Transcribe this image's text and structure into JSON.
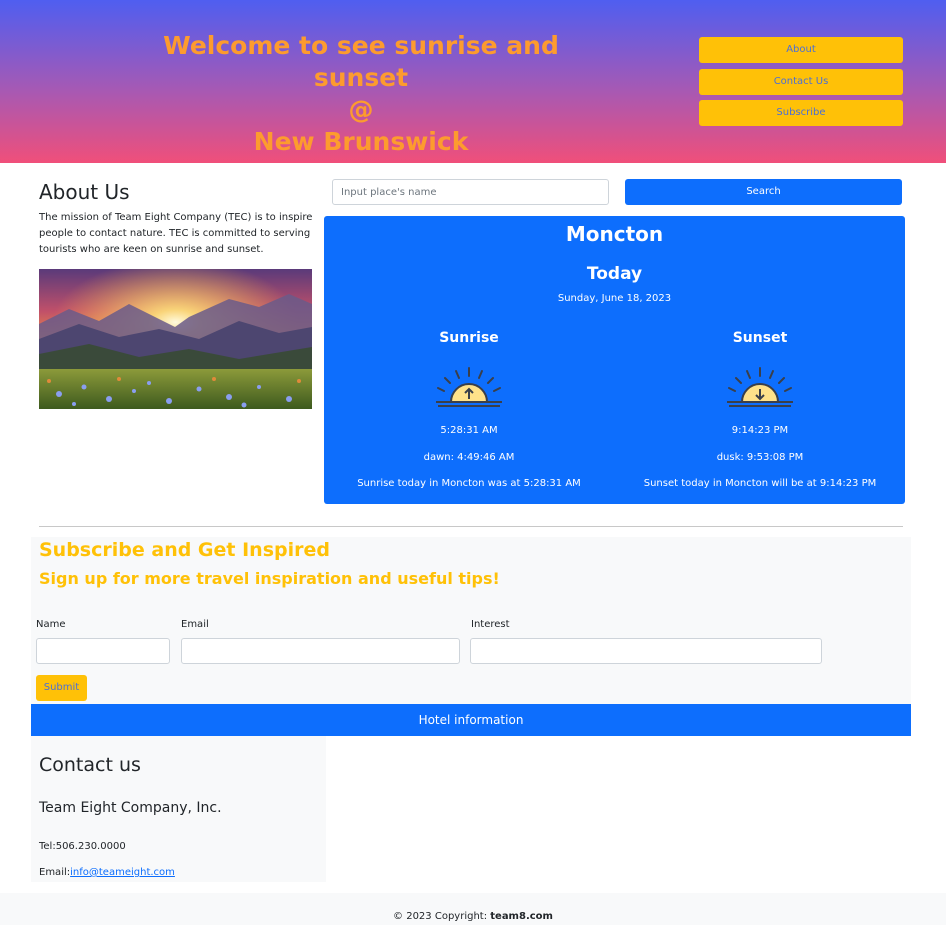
{
  "header": {
    "title_line1": "Welcome to see sunrise and sunset",
    "title_line2": "@",
    "title_line3": "New Brunswick",
    "nav": [
      "About",
      "Contact Us",
      "Subscribe"
    ]
  },
  "about": {
    "heading": "About Us",
    "text": "The mission of Team Eight Company (TEC) is to inspire people to contact nature. TEC is committed to serving tourists who are keen on sunrise and sunset."
  },
  "search": {
    "placeholder": "Input place's name",
    "button_label": "Search"
  },
  "sun_card": {
    "city": "Moncton",
    "today_label": "Today",
    "date": "Sunday, June 18, 2023",
    "sunrise": {
      "title": "Sunrise",
      "time": "5:28:31 AM",
      "twilight": "dawn: 4:49:46 AM",
      "sentence": "Sunrise today in Moncton was at 5:28:31 AM"
    },
    "sunset": {
      "title": "Sunset",
      "time": "9:14:23 PM",
      "twilight": "dusk: 9:53:08 PM",
      "sentence": "Sunset today in Moncton will be at 9:14:23 PM"
    }
  },
  "subscribe": {
    "title": "Subscribe and Get Inspired",
    "subtitle": "Sign up for more travel inspiration and useful tips!",
    "name_label": "Name",
    "email_label": "Email",
    "interest_label": "Interest",
    "submit_label": "Submit"
  },
  "hotel_bar_label": "Hotel information",
  "contact": {
    "title": "Contact us",
    "company": "Team Eight Company, Inc.",
    "tel": "Tel:506.230.0000",
    "email_prefix": "Email:",
    "email": "info@teameight.com"
  },
  "footer": {
    "copyright": "© 2023 Copyright: ",
    "brand": "team8.com"
  },
  "colors": {
    "accent": "#ffc107",
    "primary": "#0d6efd",
    "header_top": "#4f5ef0",
    "header_bottom": "#f04f7a"
  }
}
